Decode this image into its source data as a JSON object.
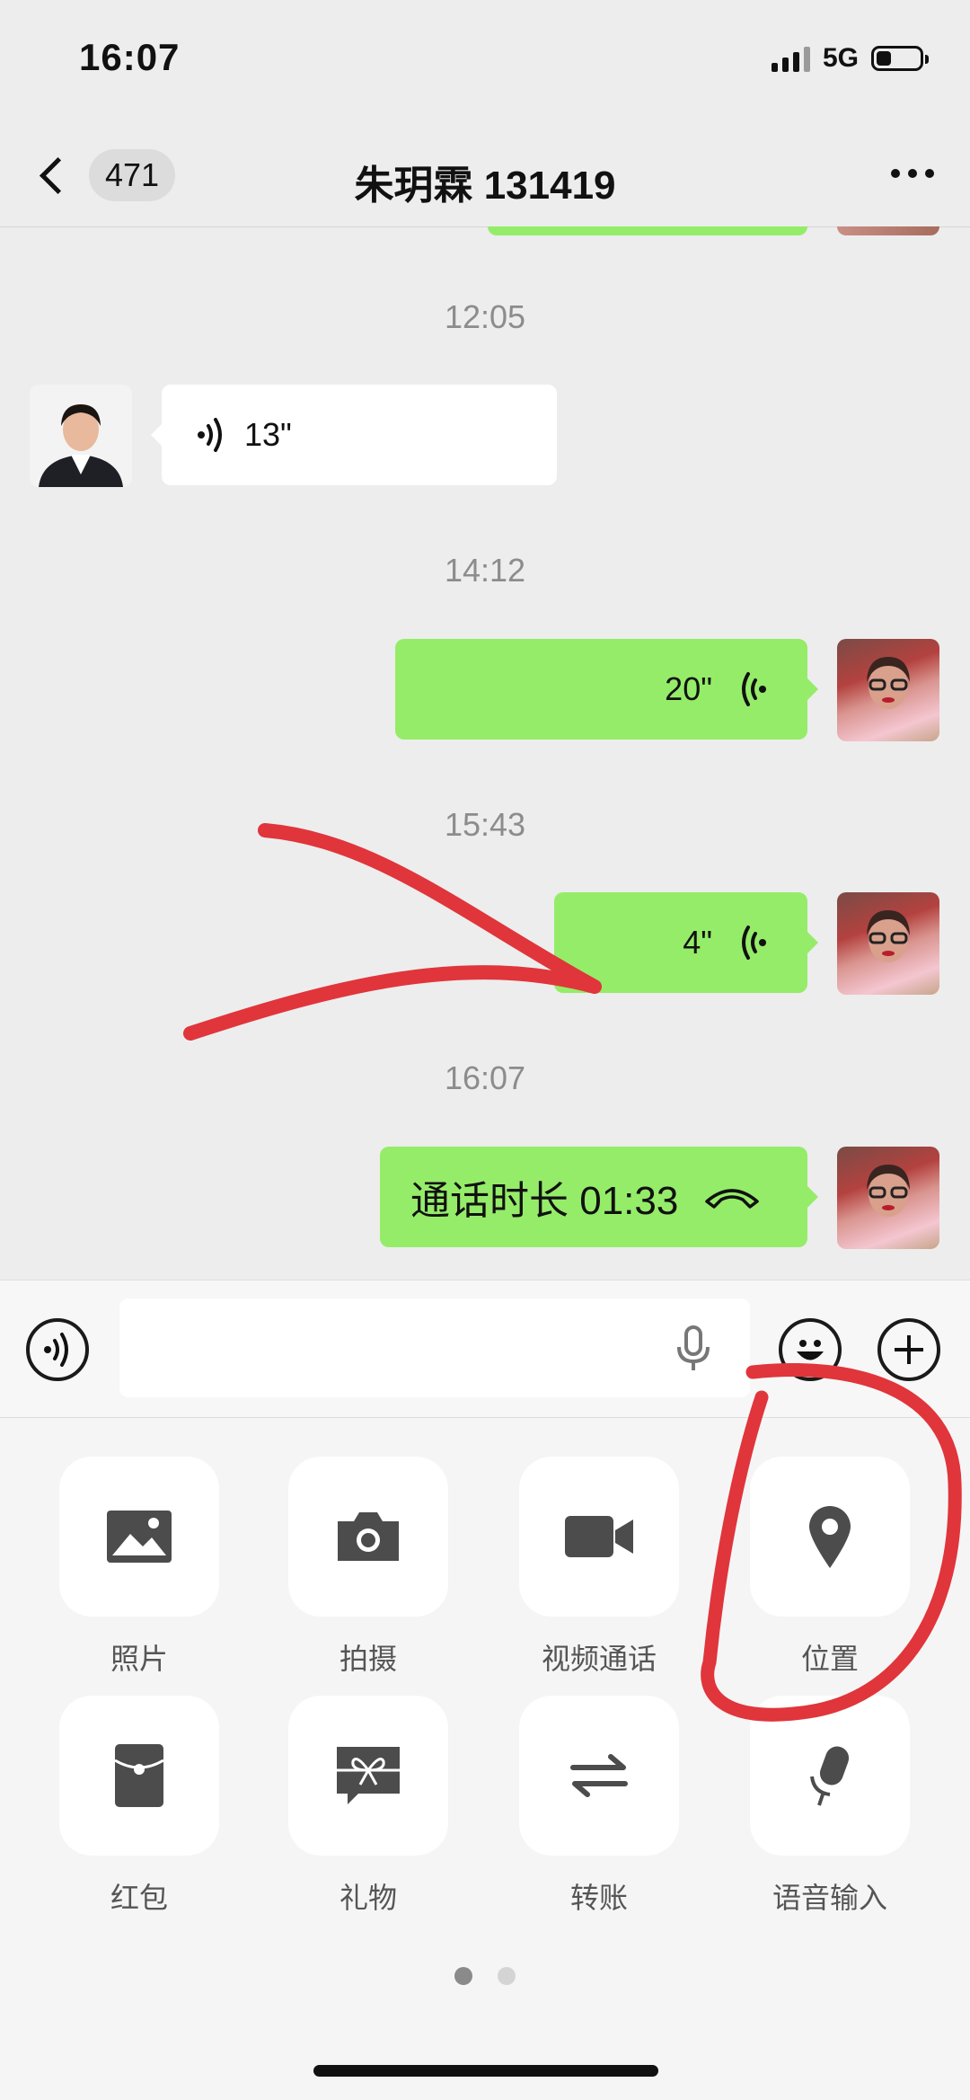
{
  "status_bar": {
    "time": "16:07",
    "network": "5G"
  },
  "nav": {
    "unread_count": "471",
    "title": "朱玥霖 131419"
  },
  "messages": [
    {
      "timestamp": "12:05",
      "direction": "incoming",
      "type": "voice",
      "duration": "13\""
    },
    {
      "timestamp": "14:12",
      "direction": "outgoing",
      "type": "voice",
      "duration": "20\""
    },
    {
      "timestamp": "15:43",
      "direction": "outgoing",
      "type": "voice",
      "duration": "4\""
    },
    {
      "timestamp": "16:07",
      "direction": "outgoing",
      "type": "call",
      "text": "通话时长 01:33"
    }
  ],
  "input": {
    "placeholder": ""
  },
  "actions": [
    {
      "label": "照片",
      "icon": "photo-icon"
    },
    {
      "label": "拍摄",
      "icon": "camera-icon"
    },
    {
      "label": "视频通话",
      "icon": "video-call-icon"
    },
    {
      "label": "位置",
      "icon": "location-icon"
    },
    {
      "label": "红包",
      "icon": "red-packet-icon"
    },
    {
      "label": "礼物",
      "icon": "gift-icon"
    },
    {
      "label": "转账",
      "icon": "transfer-icon"
    },
    {
      "label": "语音输入",
      "icon": "voice-input-icon"
    }
  ],
  "pager": {
    "pages": 2,
    "current": 1
  },
  "colors": {
    "bubble_green": "#95ec69",
    "annotation_red": "#e0353b",
    "background": "#ededed"
  }
}
